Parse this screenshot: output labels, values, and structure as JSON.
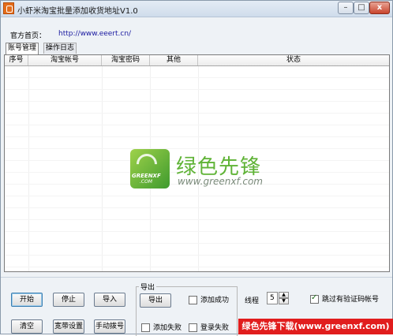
{
  "window": {
    "title": "小虾米淘宝批量添加收货地址V1.0",
    "minimize": "–",
    "maximize": "□",
    "close": "x"
  },
  "official": {
    "label": "官方首页：",
    "url": "http://www.eeert.cn/"
  },
  "tabs": [
    {
      "label": "账号管理",
      "active": true
    },
    {
      "label": "操作日志",
      "active": false
    }
  ],
  "table": {
    "columns": [
      "序号",
      "淘宝帐号",
      "淘宝密码",
      "其他",
      "状态"
    ],
    "rows": []
  },
  "watermark": {
    "logo_text": "GREENXF",
    "logo_sub": ".COM",
    "brand": "绿色先锋",
    "url": "www.greenxf.com"
  },
  "buttons": {
    "start": "开始",
    "stop": "停止",
    "import": "导入",
    "clear": "清空",
    "broadband": "宽带设置",
    "manual_dial": "手动拨号",
    "export": "导出"
  },
  "export_group": {
    "title": "导出",
    "add_success": {
      "label": "添加成功",
      "checked": false
    },
    "add_fail": {
      "label": "添加失败",
      "checked": false
    },
    "login_fail": {
      "label": "登录失败",
      "checked": false
    }
  },
  "threads": {
    "label": "线程",
    "value": "5"
  },
  "skip_captcha": {
    "label": "跳过有验证码帐号",
    "checked": true
  },
  "banner": {
    "text": "绿色先锋下载(www.greenxf.com)"
  }
}
